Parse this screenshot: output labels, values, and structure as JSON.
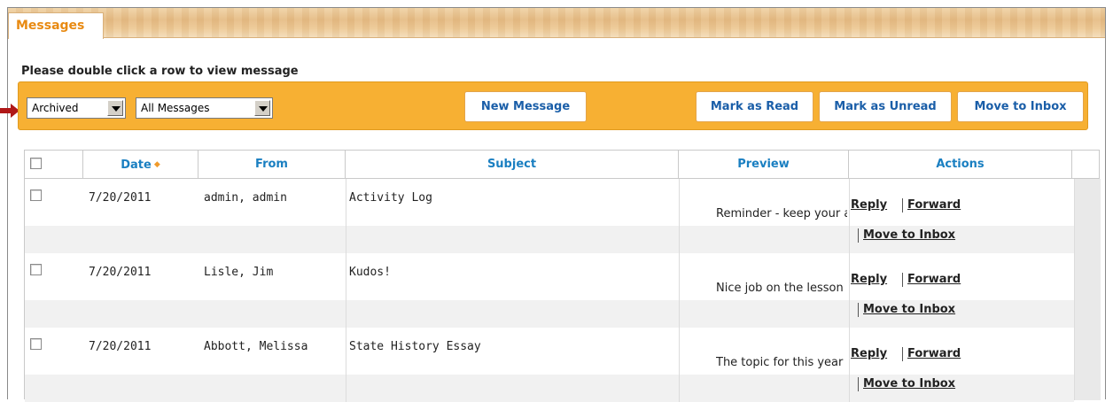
{
  "tabs": {
    "messages_label": "Messages"
  },
  "instruction": "Please double click a row to view message",
  "toolbar": {
    "folder_select": "Archived",
    "filter_select": "All Messages",
    "new_message": "New Message",
    "mark_read": "Mark as Read",
    "mark_unread": "Mark as Unread",
    "move_inbox": "Move to Inbox",
    "accent": "#f7b033"
  },
  "grid": {
    "headers": {
      "date": "Date",
      "from": "From",
      "subject": "Subject",
      "preview": "Preview",
      "actions": "Actions"
    },
    "header_color": "#1a7fc1",
    "rows": [
      {
        "date": "7/20/2011",
        "from": "admin, admin",
        "subject": "Activity Log",
        "preview": "Reminder - keep your activity log",
        "reply": "Reply",
        "forward": "Forward",
        "move": "Move to Inbox"
      },
      {
        "date": "7/20/2011",
        "from": "Lisle, Jim",
        "subject": "Kudos!",
        "preview": "Nice job on the lesson",
        "reply": "Reply",
        "forward": "Forward",
        "move": "Move to Inbox"
      },
      {
        "date": "7/20/2011",
        "from": "Abbott, Melissa",
        "subject": "State History Essay",
        "preview": "The topic for this year",
        "reply": "Reply",
        "forward": "Forward",
        "move": "Move to Inbox"
      }
    ]
  }
}
